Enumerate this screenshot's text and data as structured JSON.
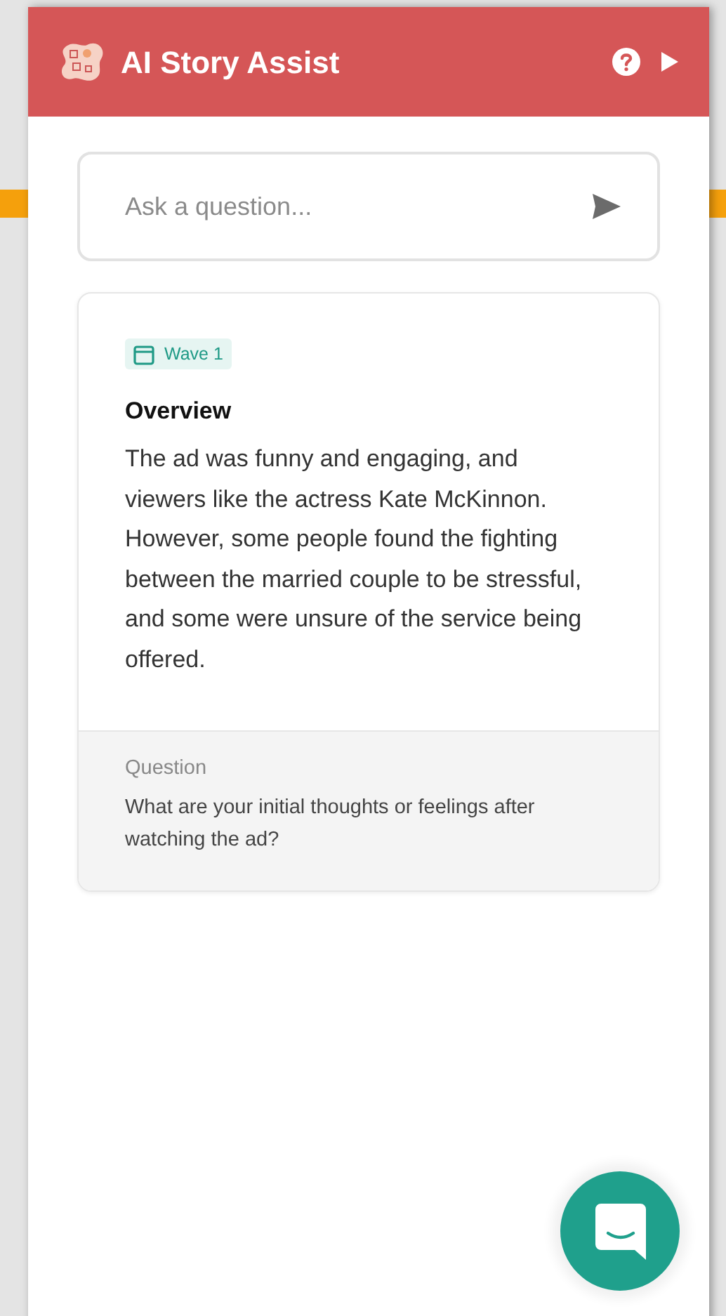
{
  "header": {
    "title": "AI Story Assist"
  },
  "search": {
    "placeholder": "Ask a question..."
  },
  "card": {
    "tag": "Wave 1",
    "heading": "Overview",
    "summary": "The ad was funny and engaging, and viewers like the actress Kate McKinnon. However, some people found the fighting between the married couple to be stressful, and some were unsure of the service being offered.",
    "question_label": "Question",
    "question": "What are your initial thoughts or feelings after watching the ad?"
  }
}
